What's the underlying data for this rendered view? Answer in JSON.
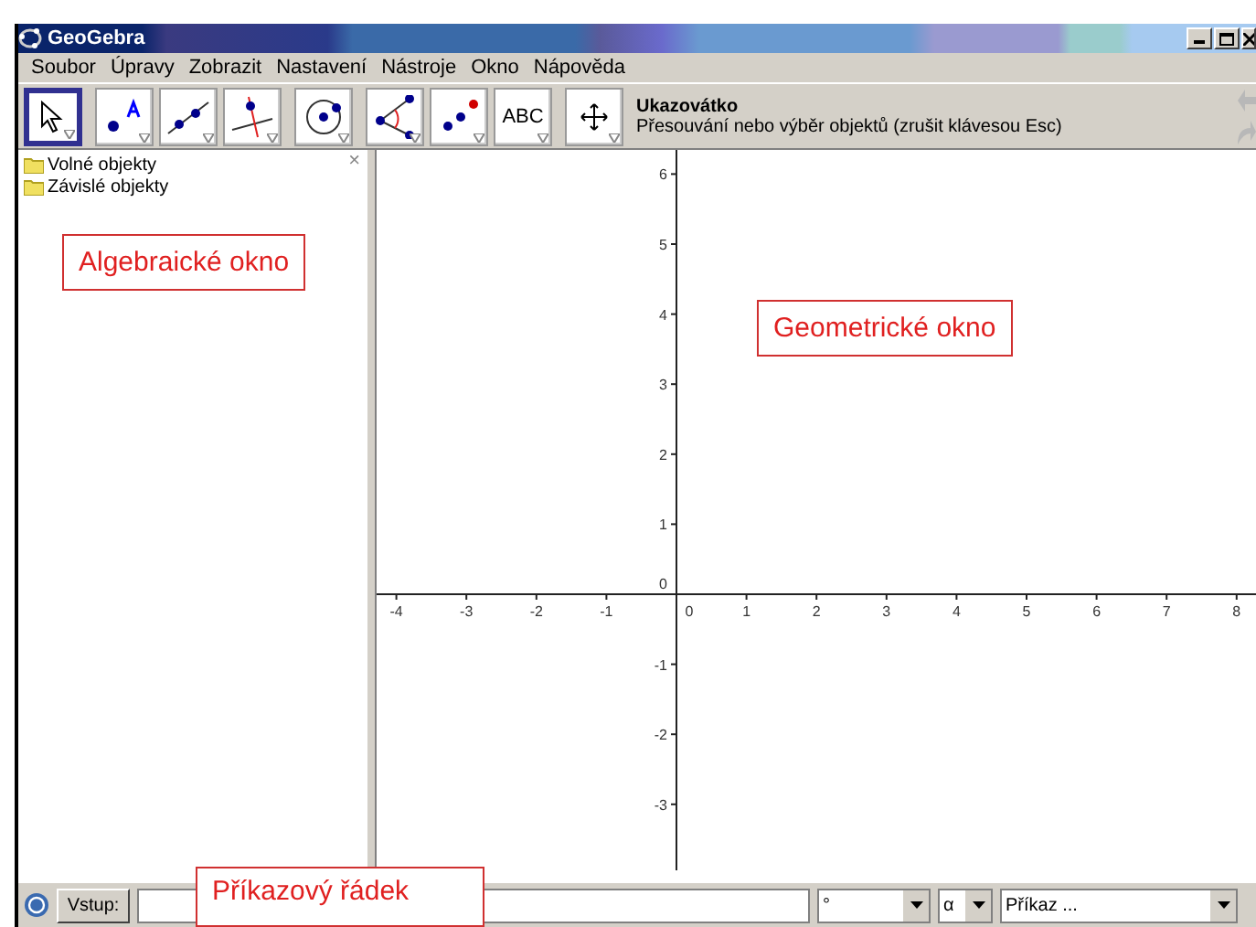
{
  "window": {
    "title": "GeoGebra"
  },
  "menu": [
    "Soubor",
    "Úpravy",
    "Zobrazit",
    "Nastavení",
    "Nástroje",
    "Okno",
    "Nápověda"
  ],
  "toolbar": {
    "groups": [
      [
        {
          "kind": "pointer",
          "selected": true
        }
      ],
      [
        {
          "kind": "point",
          "selected": false
        },
        {
          "kind": "line",
          "selected": false
        },
        {
          "kind": "perpendicular",
          "selected": false
        }
      ],
      [
        {
          "kind": "circle",
          "selected": false
        }
      ],
      [
        {
          "kind": "angle",
          "selected": false
        },
        {
          "kind": "reflect",
          "selected": false
        },
        {
          "kind": "text",
          "label": "ABC",
          "selected": false
        }
      ],
      [
        {
          "kind": "move-view",
          "selected": false
        }
      ]
    ],
    "tool_name": "Ukazovátko",
    "tool_help": "Přesouvání nebo výběr objektů (zrušit klávesou Esc)"
  },
  "algebra": {
    "folders": [
      "Volné objekty",
      "Závislé objekty"
    ],
    "close": "×"
  },
  "graphics": {
    "x_ticks": [
      "-4",
      "-3",
      "-2",
      "-1",
      "0",
      "1",
      "2",
      "3",
      "4",
      "5",
      "6",
      "7",
      "8"
    ],
    "y_ticks": [
      "6",
      "5",
      "4",
      "3",
      "2",
      "1",
      "0",
      "-1",
      "-2",
      "-3"
    ]
  },
  "annotations": [
    {
      "text": "Algebraické okno"
    },
    {
      "text": "Geometrické okno"
    },
    {
      "text": "Příkazový řádek"
    }
  ],
  "input_bar": {
    "button": "Vstup:",
    "degree": "°",
    "alpha": "α",
    "command": "Příkaz ..."
  }
}
